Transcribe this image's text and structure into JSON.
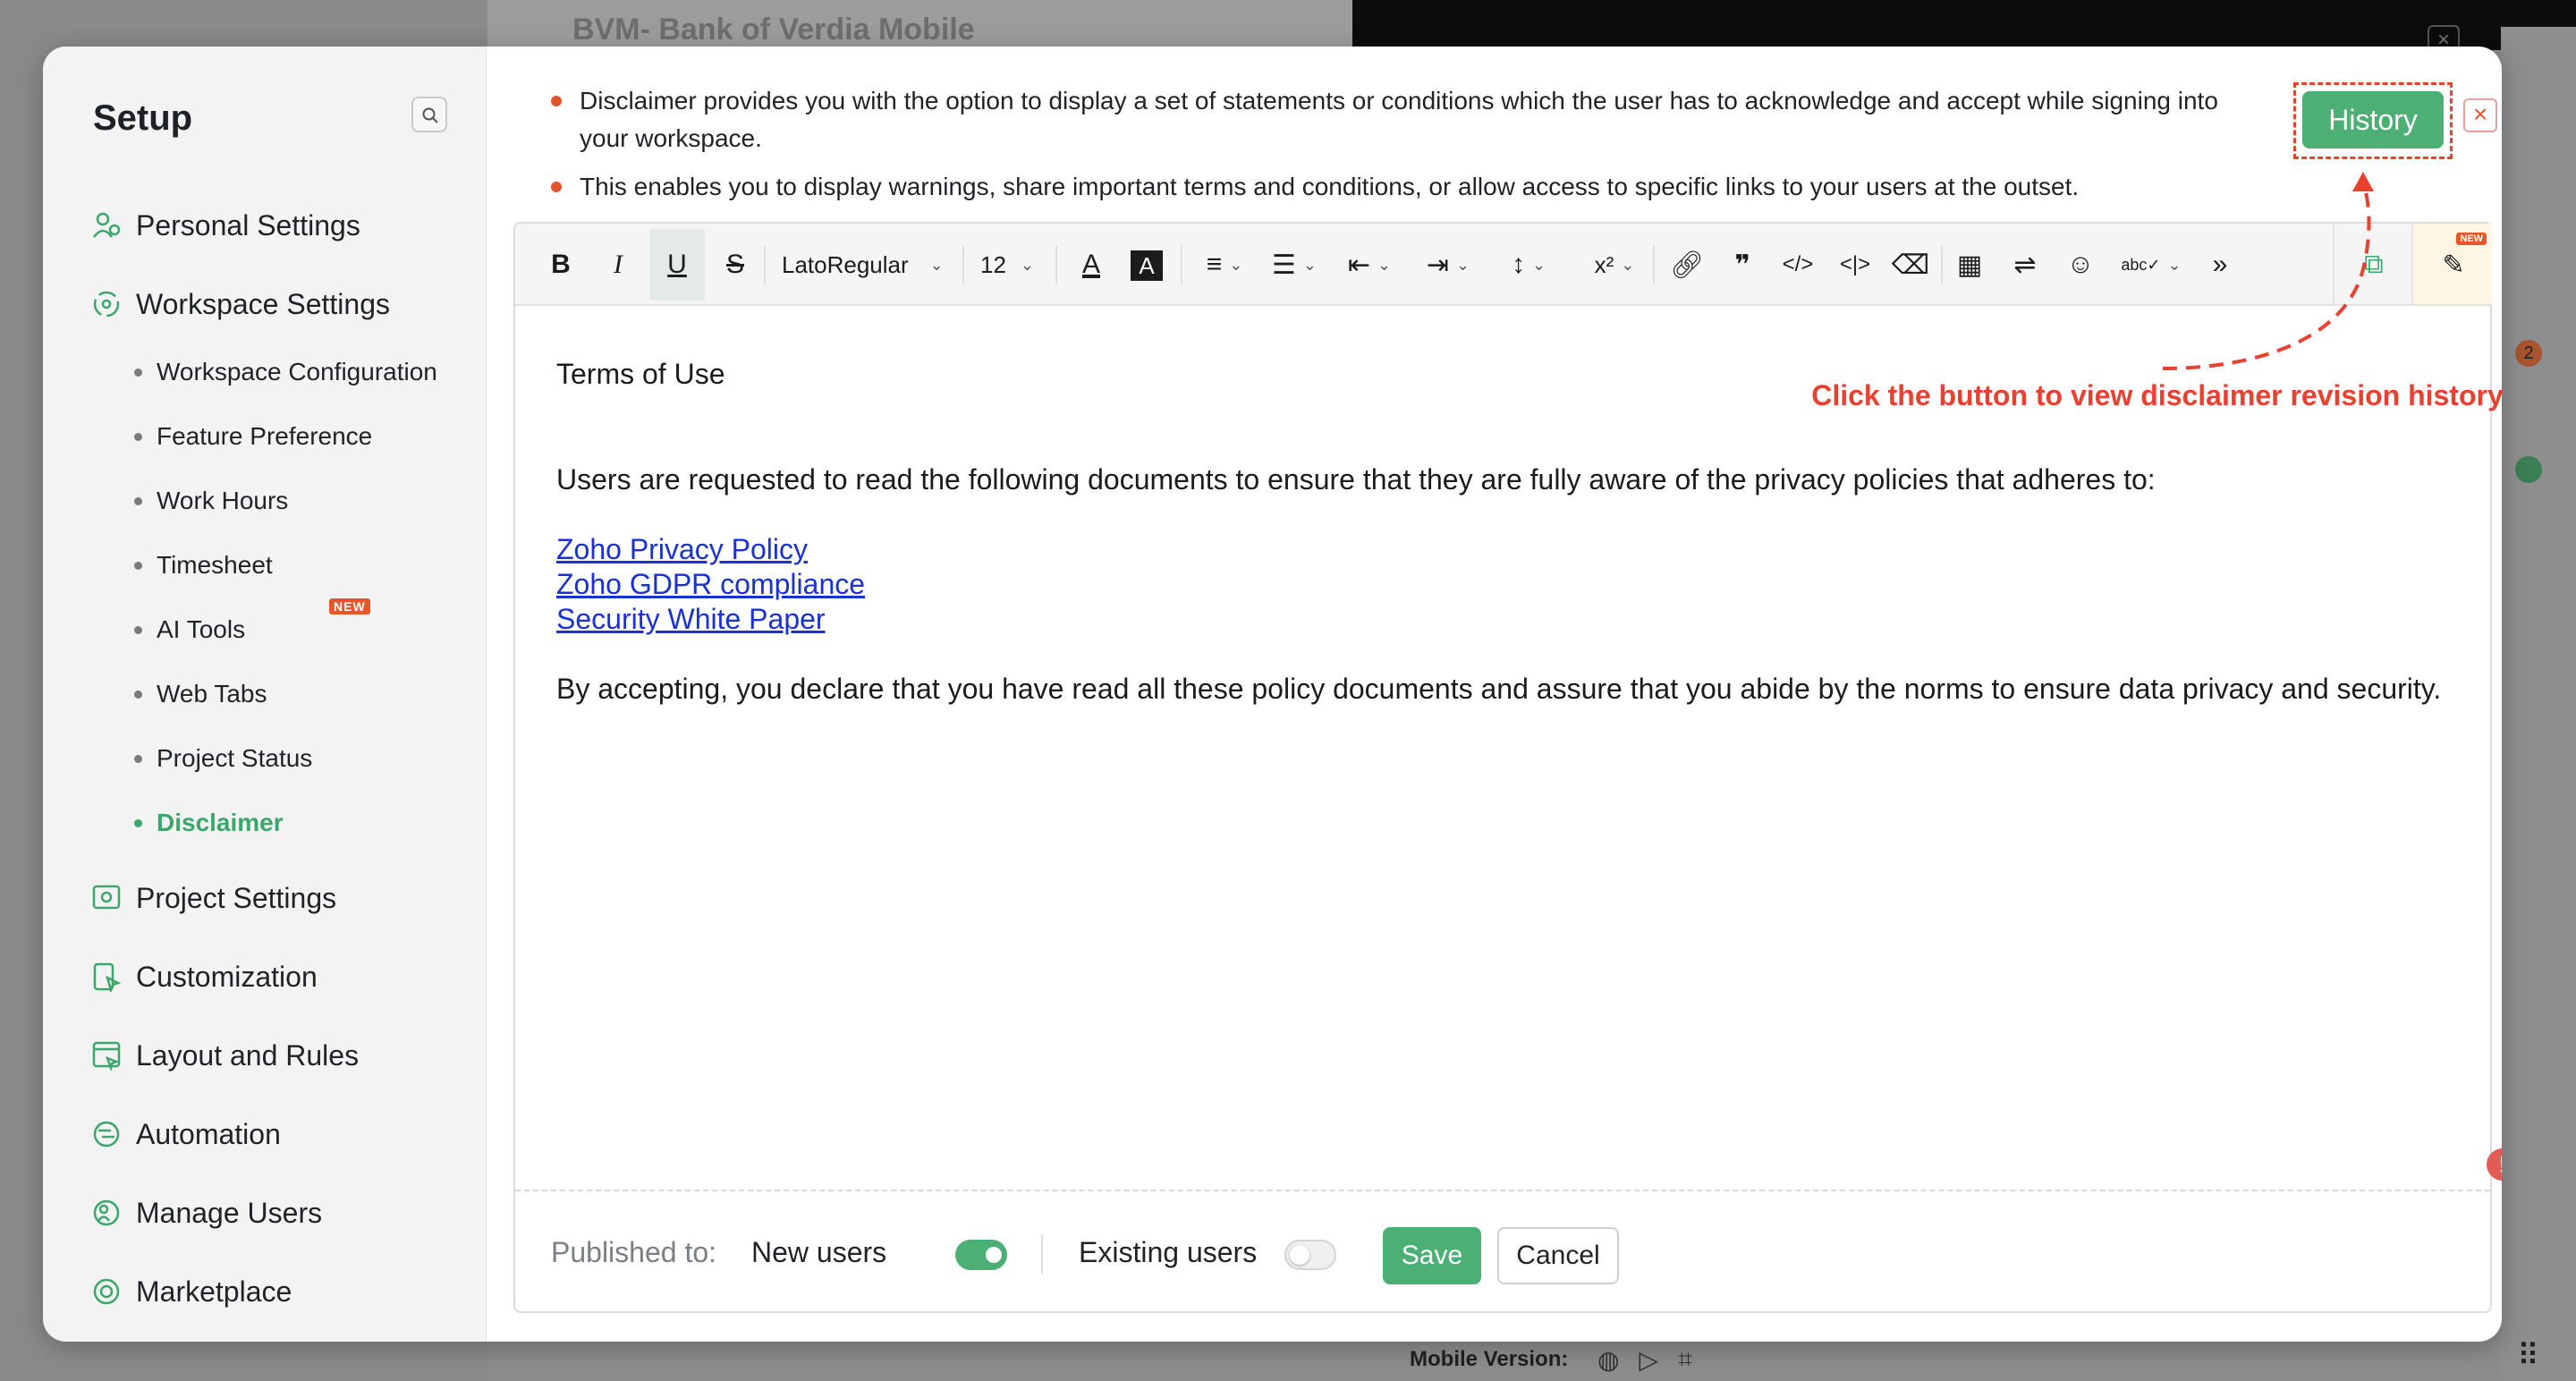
{
  "background": {
    "project_title": "BVM- Bank of Verdia Mobile",
    "mobile_version_label": "Mobile Version:",
    "badge_count": "2"
  },
  "sidebar": {
    "title": "Setup",
    "items": [
      {
        "label": "Personal Settings",
        "icon": "person-settings-icon"
      },
      {
        "label": "Workspace Settings",
        "icon": "workspace-icon"
      },
      {
        "label": "Project Settings",
        "icon": "project-icon"
      },
      {
        "label": "Customization",
        "icon": "customization-icon"
      },
      {
        "label": "Layout and Rules",
        "icon": "layout-icon"
      },
      {
        "label": "Automation",
        "icon": "automation-icon"
      },
      {
        "label": "Manage Users",
        "icon": "users-icon"
      },
      {
        "label": "Marketplace",
        "icon": "marketplace-icon"
      }
    ],
    "workspace_sub": [
      {
        "label": "Workspace Configuration"
      },
      {
        "label": "Feature Preference"
      },
      {
        "label": "Work Hours"
      },
      {
        "label": "Timesheet"
      },
      {
        "label": "AI Tools",
        "badge": "NEW"
      },
      {
        "label": "Web Tabs"
      },
      {
        "label": "Project Status"
      },
      {
        "label": "Disclaimer",
        "active": true
      }
    ]
  },
  "info": {
    "line1": "Disclaimer provides you with the option to display a set of statements or conditions which the user has to acknowledge and accept while signing into your workspace.",
    "line2": "This enables you to display warnings, share important terms and conditions, or allow access to specific links to your users at the outset."
  },
  "history_label": "History",
  "annotation": "Click the button to view disclaimer revision history",
  "toolbar": {
    "font_family": "LatoRegular",
    "font_size": "12",
    "new_badge": "NEW"
  },
  "editor": {
    "heading": "Terms of Use",
    "intro": "Users are requested to read the following documents to ensure that they are fully aware of the privacy policies that adheres to:",
    "links": [
      "Zoho Privacy Policy",
      "Zoho GDPR compliance",
      "Security White Paper"
    ],
    "closing": "By accepting, you declare that you have read all these policy documents and assure that you abide by the norms to ensure data privacy and security."
  },
  "footer": {
    "published_label": "Published to:",
    "new_users_label": "New users",
    "new_users_enabled": true,
    "existing_users_label": "Existing users",
    "existing_users_enabled": false,
    "save_label": "Save",
    "cancel_label": "Cancel"
  },
  "colors": {
    "accent_green": "#4caf74",
    "annotation_red": "#e8412f",
    "link_blue": "#1a31d6"
  }
}
